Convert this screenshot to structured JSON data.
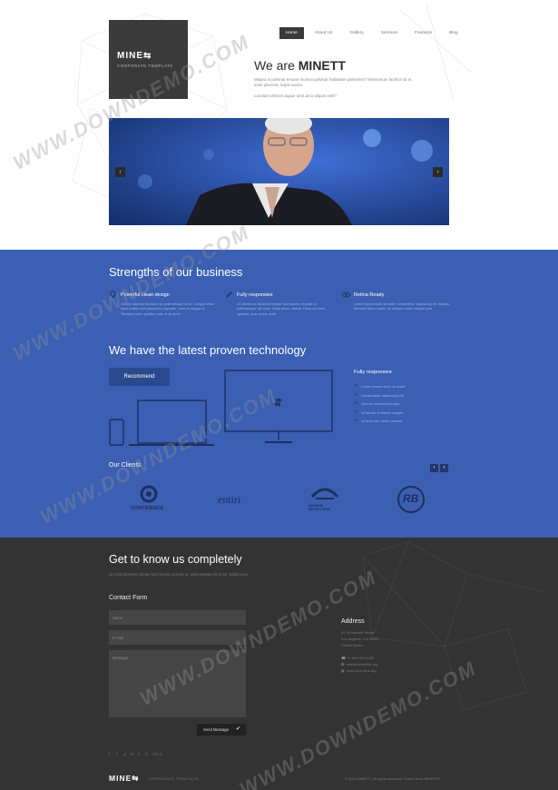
{
  "header": {
    "logo": "MINE",
    "logo_mark": "⇆",
    "logo_sub": "CORPORATE TEMPLATE",
    "nav": [
      "Home",
      "About Us",
      "Gallery",
      "Services",
      "Features",
      "Blog"
    ],
    "hero_title_prefix": "We are ",
    "hero_title_brand": "MINETT",
    "hero_desc": "Magna in pulvinar tempor montes pulvinar habitasse parturient? Elementum facilisis sit et, dolor placerat, turpis auctor.",
    "hero_desc2": "Lundium ultrices augue urna arcu aliquet velit?"
  },
  "slider": {
    "prev": "‹",
    "next": "›"
  },
  "strengths": {
    "title": "Strengths of our business",
    "items": [
      {
        "title": "Powerful clean design",
        "text": "Ornare dapibus tincidunt ac pellentesque et ac. Congue vitae diam mattis eros phasellus vulputate, urna et magna et. Tincidunt dolor porttitor odio ut sit amet.",
        "icon": "lightbulb-icon"
      },
      {
        "title": "Fully responsive",
        "text": "Ut ultrices ac dictumst integer sed mauris ut porta ut, pellentesque elit amet. Nulla lacus, massa. Diam vel enim egestas, quis varius amet.",
        "icon": "pencil-icon"
      },
      {
        "title": "Retina Ready",
        "text": "Lorem ipsum dolor sit amet, consectetur adipiscing elit. Mauris tincidunt libero turpis, eu tristique odio volutpat quis.",
        "icon": "eye-icon"
      }
    ]
  },
  "technology": {
    "title": "We have the latest proven technology",
    "button": "Recommend",
    "list_title": "Fully responsive",
    "list": [
      "Lorem ipsum dolor sit amet",
      "Consectetur adipiscing elit",
      "Sed do eiusmod tempor",
      "Ut labore et dolore magna",
      "Ut enim ad minim veniam"
    ]
  },
  "clients": {
    "title": "Our Clients",
    "prev": "‹",
    "next": "›",
    "logos": [
      "CONFIDENCE",
      "entiri",
      "SARDINE REVOLUTION",
      "RB"
    ]
  },
  "footer": {
    "title": "Get to know us completely",
    "desc": "Ut porta dictumst integer sed mauris ut porta ut, pellentesque elit amet. Nulla lacus.",
    "contact_title": "Contact Form",
    "fields": {
      "name": "Name",
      "email": "E-mail",
      "message": "Message"
    },
    "send": "Send Message",
    "address_title": "Address",
    "address": [
      "81 Sunnyvale Street",
      "Los Angeles, CA 90068",
      "United States"
    ],
    "contacts": [
      "+1 800 603 6035",
      "mail@demolink.org",
      "www.demolink.org"
    ],
    "social": [
      "f",
      "t",
      "g",
      "in",
      "v",
      "b",
      "rss",
      "p"
    ],
    "logo": "MINE",
    "tagline": "CORPORATE TEMPLATE",
    "copyright": "© 2013 MINETT. All rights reserved. Collect from WEBSITE"
  },
  "watermark": "WWW.DOWNDEMO.COM"
}
